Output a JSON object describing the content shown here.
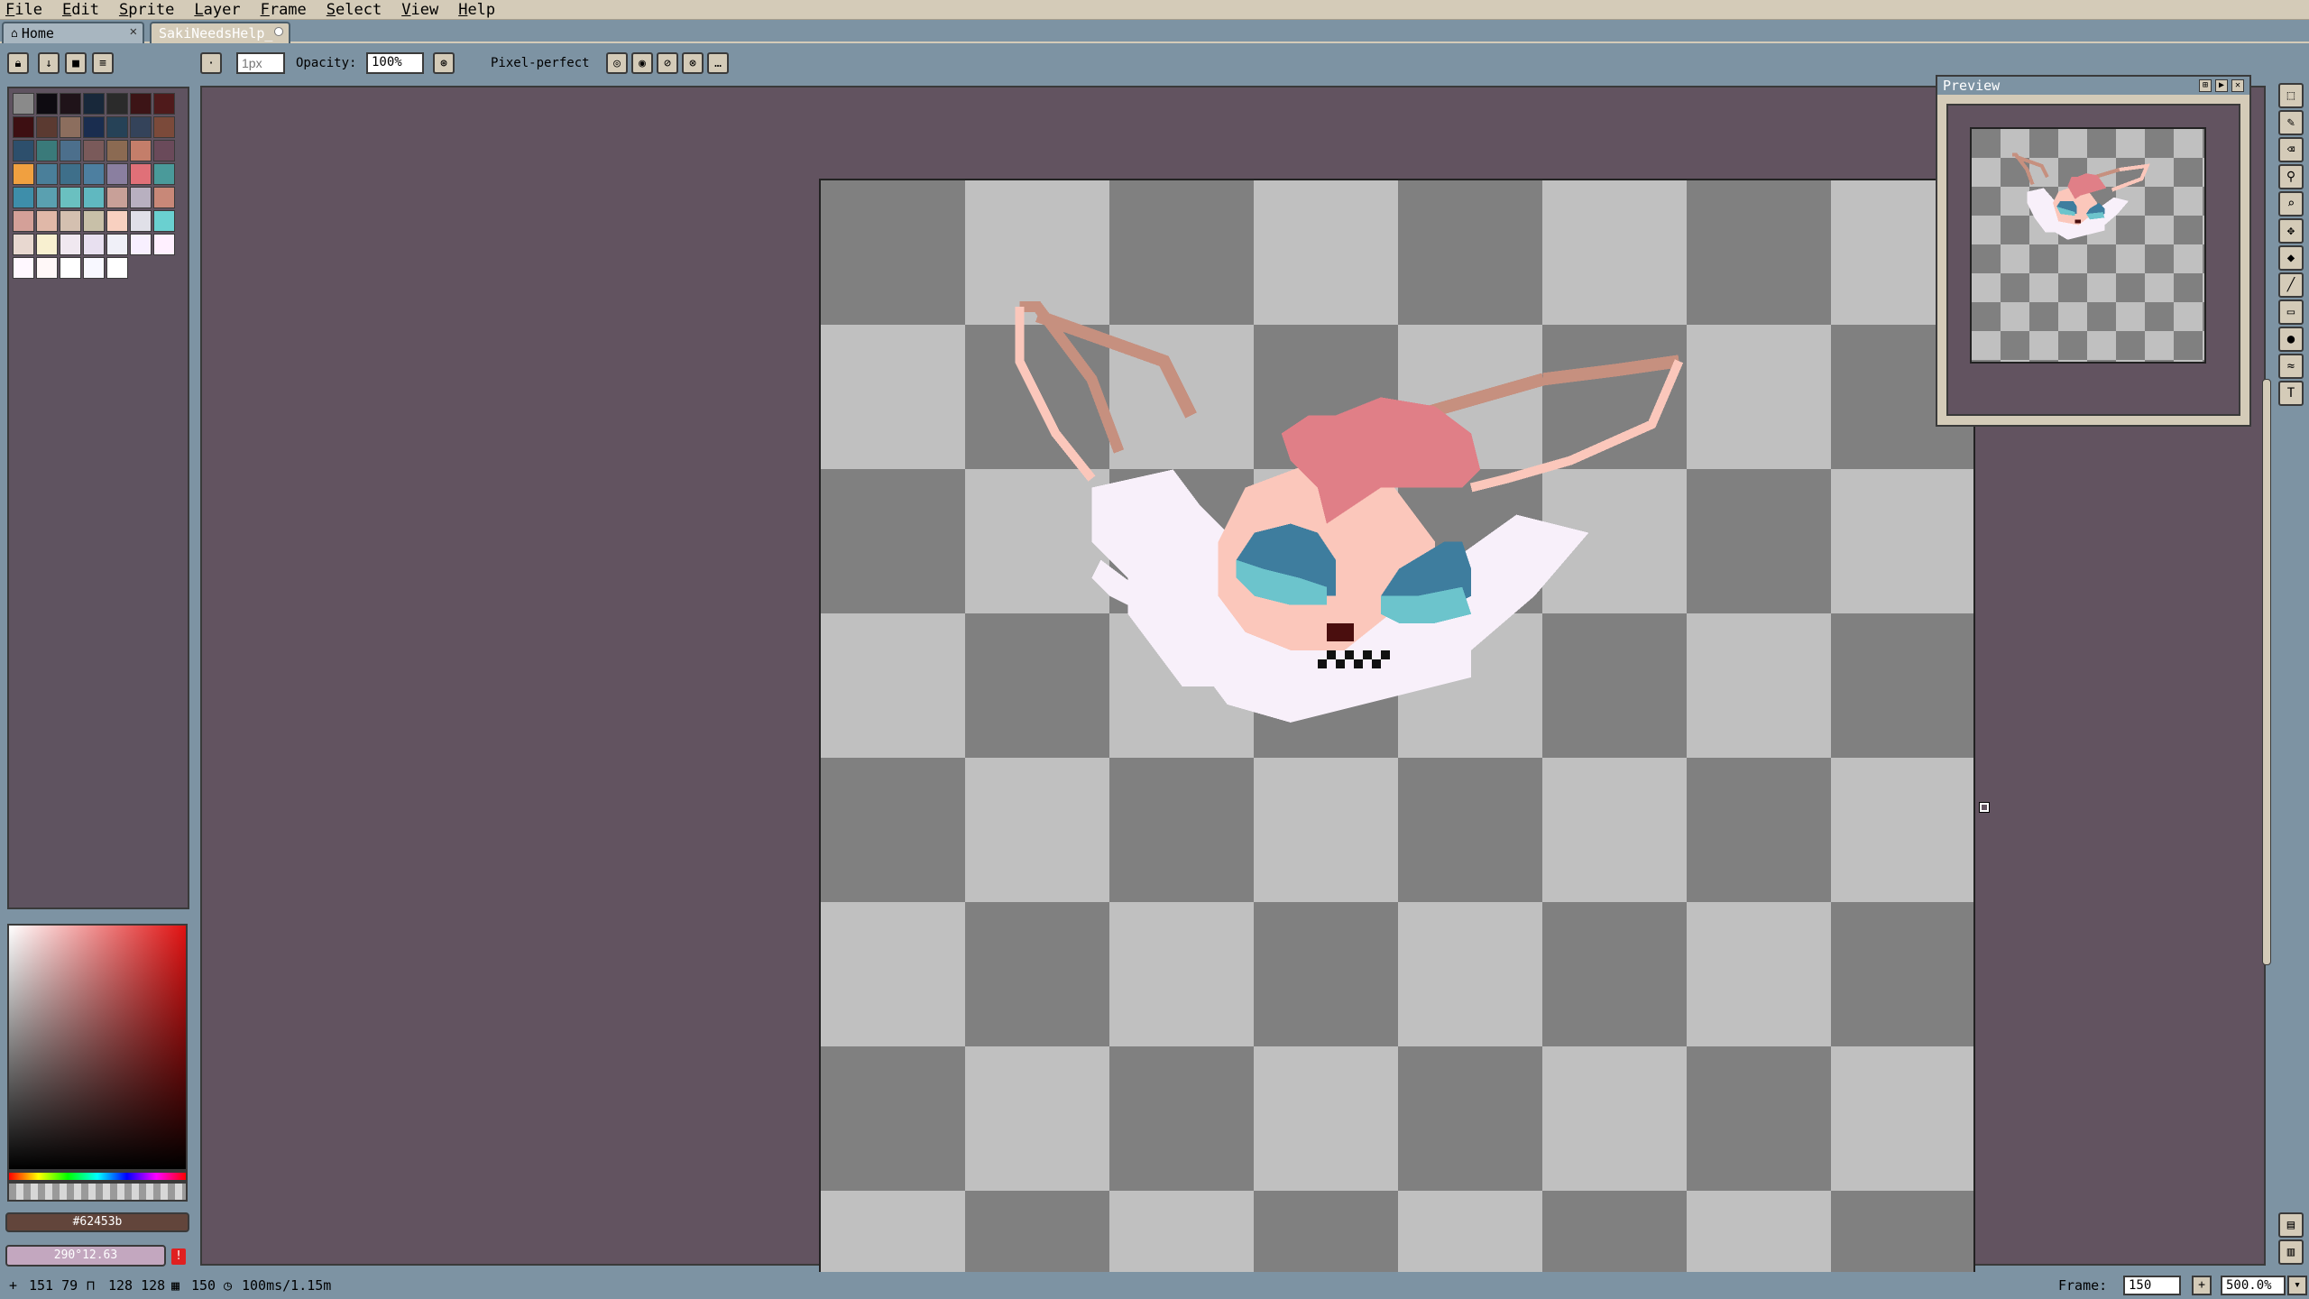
{
  "menu": [
    "File",
    "Edit",
    "Sprite",
    "Layer",
    "Frame",
    "Select",
    "View",
    "Help"
  ],
  "tabs": {
    "home": {
      "icon": "home-icon",
      "label": "Home",
      "close": "✕"
    },
    "sprite": {
      "label": "SakiNeedsHelp_"
    }
  },
  "context": {
    "brush_size_placeholder": "1px",
    "opacity_label": "Opacity:",
    "opacity_value": "100%",
    "pixel_perfect_label": "Pixel-perfect",
    "more": "…"
  },
  "palette": {
    "colors": [
      "#8a8a8a",
      "#0e0b11",
      "#1f1319",
      "#18283a",
      "#2b2b2b",
      "#3c1416",
      "#4f1a1b",
      "#3d0f12",
      "#5b3a31",
      "#8c6e5e",
      "#1a2d4f",
      "#264257",
      "#34435a",
      "#7b4a3a",
      "#2d4f6c",
      "#3a7a7a",
      "#4c6f8c",
      "#7a5a5a",
      "#8b6a52",
      "#c47e6a",
      "#6a4a5a",
      "#f0a040",
      "#4a7f9a",
      "#3e6f8a",
      "#4d7fa0",
      "#8a7fa0",
      "#e07078",
      "#4a9a9a",
      "#3e8eaa",
      "#5aa0b0",
      "#6ac0c0",
      "#60b8c0",
      "#c8a098",
      "#b8b0c0",
      "#c88878",
      "#d4a098",
      "#e0b8a8",
      "#d4c0b0",
      "#c8c0a8",
      "#f8d0c0",
      "#e0e0e8",
      "#6ad0d0",
      "#e8d8d0",
      "#f8f0d0",
      "#f0e8f0",
      "#e8e0f0",
      "#f0f0f8",
      "#f8f0ff",
      "#fff0ff",
      "#fff8ff",
      "#fff8f8",
      "#ffffff",
      "#f8f8ff",
      "#ffffff"
    ]
  },
  "color": {
    "hex": "#62453b",
    "value": "290°12.63",
    "spectrum_hue": "#e01212"
  },
  "preview": {
    "title": "Preview"
  },
  "tools": [
    "marquee-icon",
    "pencil-icon",
    "eraser-icon",
    "eyedropper-icon",
    "zoom-icon",
    "move-icon",
    "fill-icon",
    "line-icon",
    "rectangle-icon",
    "blur-icon",
    "smudge-icon",
    "text-icon"
  ],
  "status": {
    "position": "151 79",
    "size": "128 128",
    "frame_num": "150",
    "duration": "100ms/1.15m",
    "frame_label": "Frame:",
    "frame_value": "150",
    "zoom_value": "500.0%"
  },
  "sprite_colors": {
    "white": "#f8f0fa",
    "pink": "#e07f87",
    "peach": "#fbc7bb",
    "ear_outline": "#fbc7bb",
    "ear_dark": "#c6907f",
    "eye_blue": "#3e7d9e",
    "eye_cyan": "#6cc4cc",
    "nose": "#4a0e0e",
    "mouth": "#111111"
  }
}
